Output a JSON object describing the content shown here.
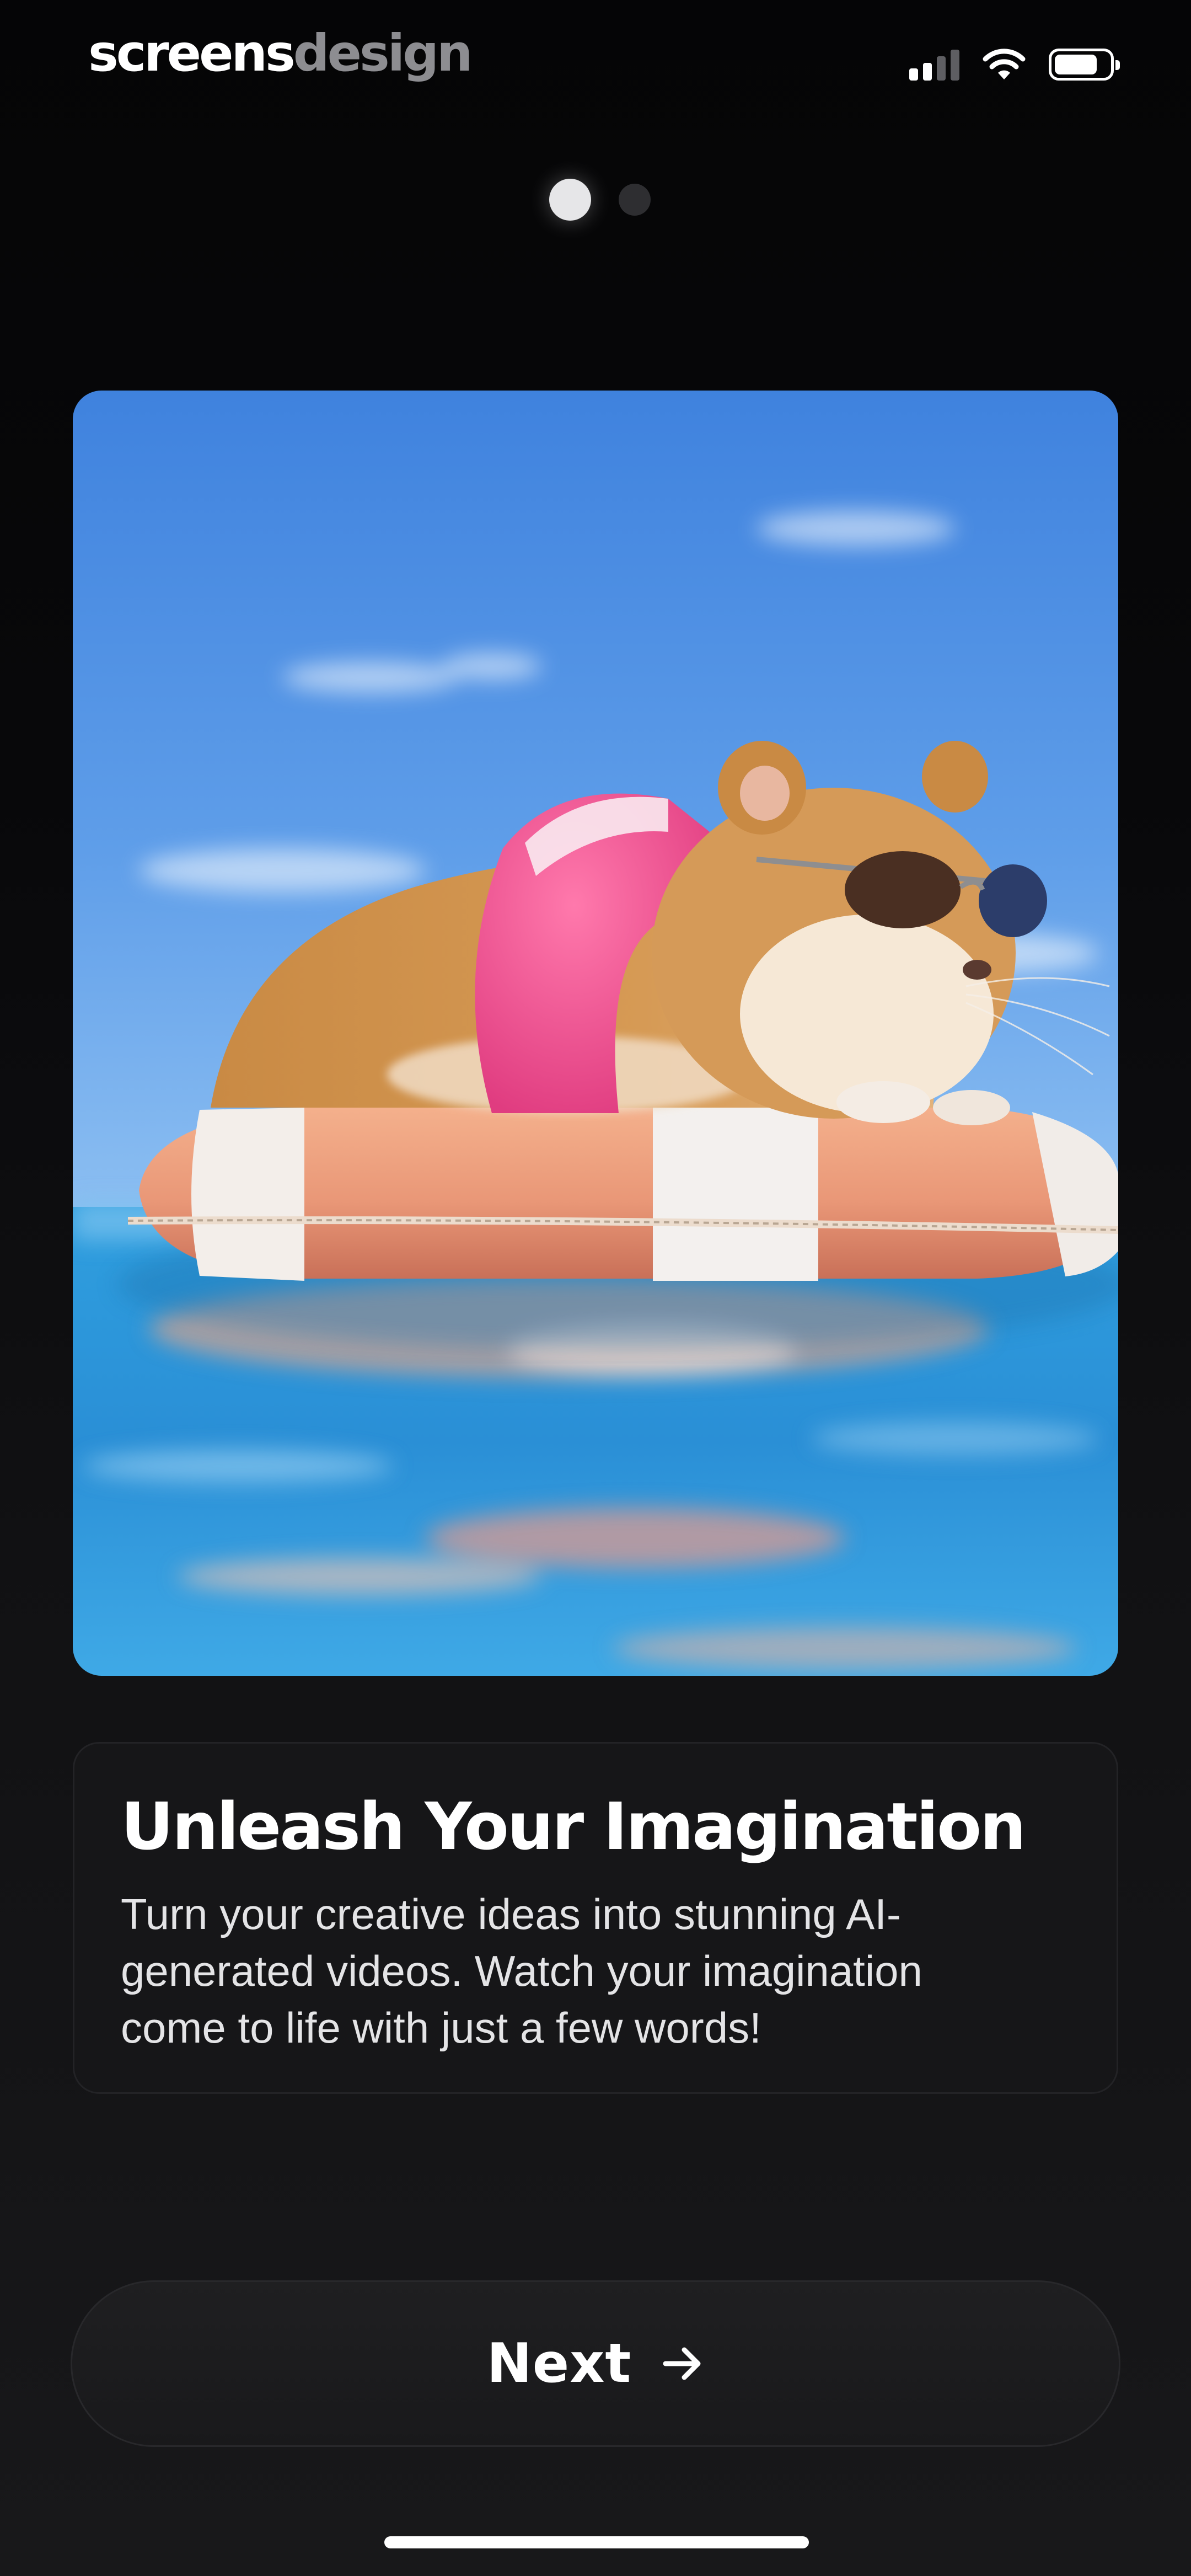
{
  "status_bar": {
    "brand_part1": "screens",
    "brand_part2": "design",
    "icons": [
      "cellular-signal-icon",
      "wifi-icon",
      "battery-icon"
    ]
  },
  "pager": {
    "total": 2,
    "current": 1
  },
  "hero": {
    "image": "hamster-with-sunglasses-on-float-ring-icon"
  },
  "card": {
    "title": "Unleash Your Imagination",
    "description": "Turn your creative ideas into stunning AI-generated videos. Watch your imagination come to life with just a few words!"
  },
  "next_button": {
    "label": "Next",
    "icon": "arrow-right-icon"
  },
  "colors": {
    "background": "#0a0a0b",
    "card": "#161618",
    "button": "#1f1f21",
    "text": "#ffffff",
    "brand_muted": "#8d8d91"
  }
}
